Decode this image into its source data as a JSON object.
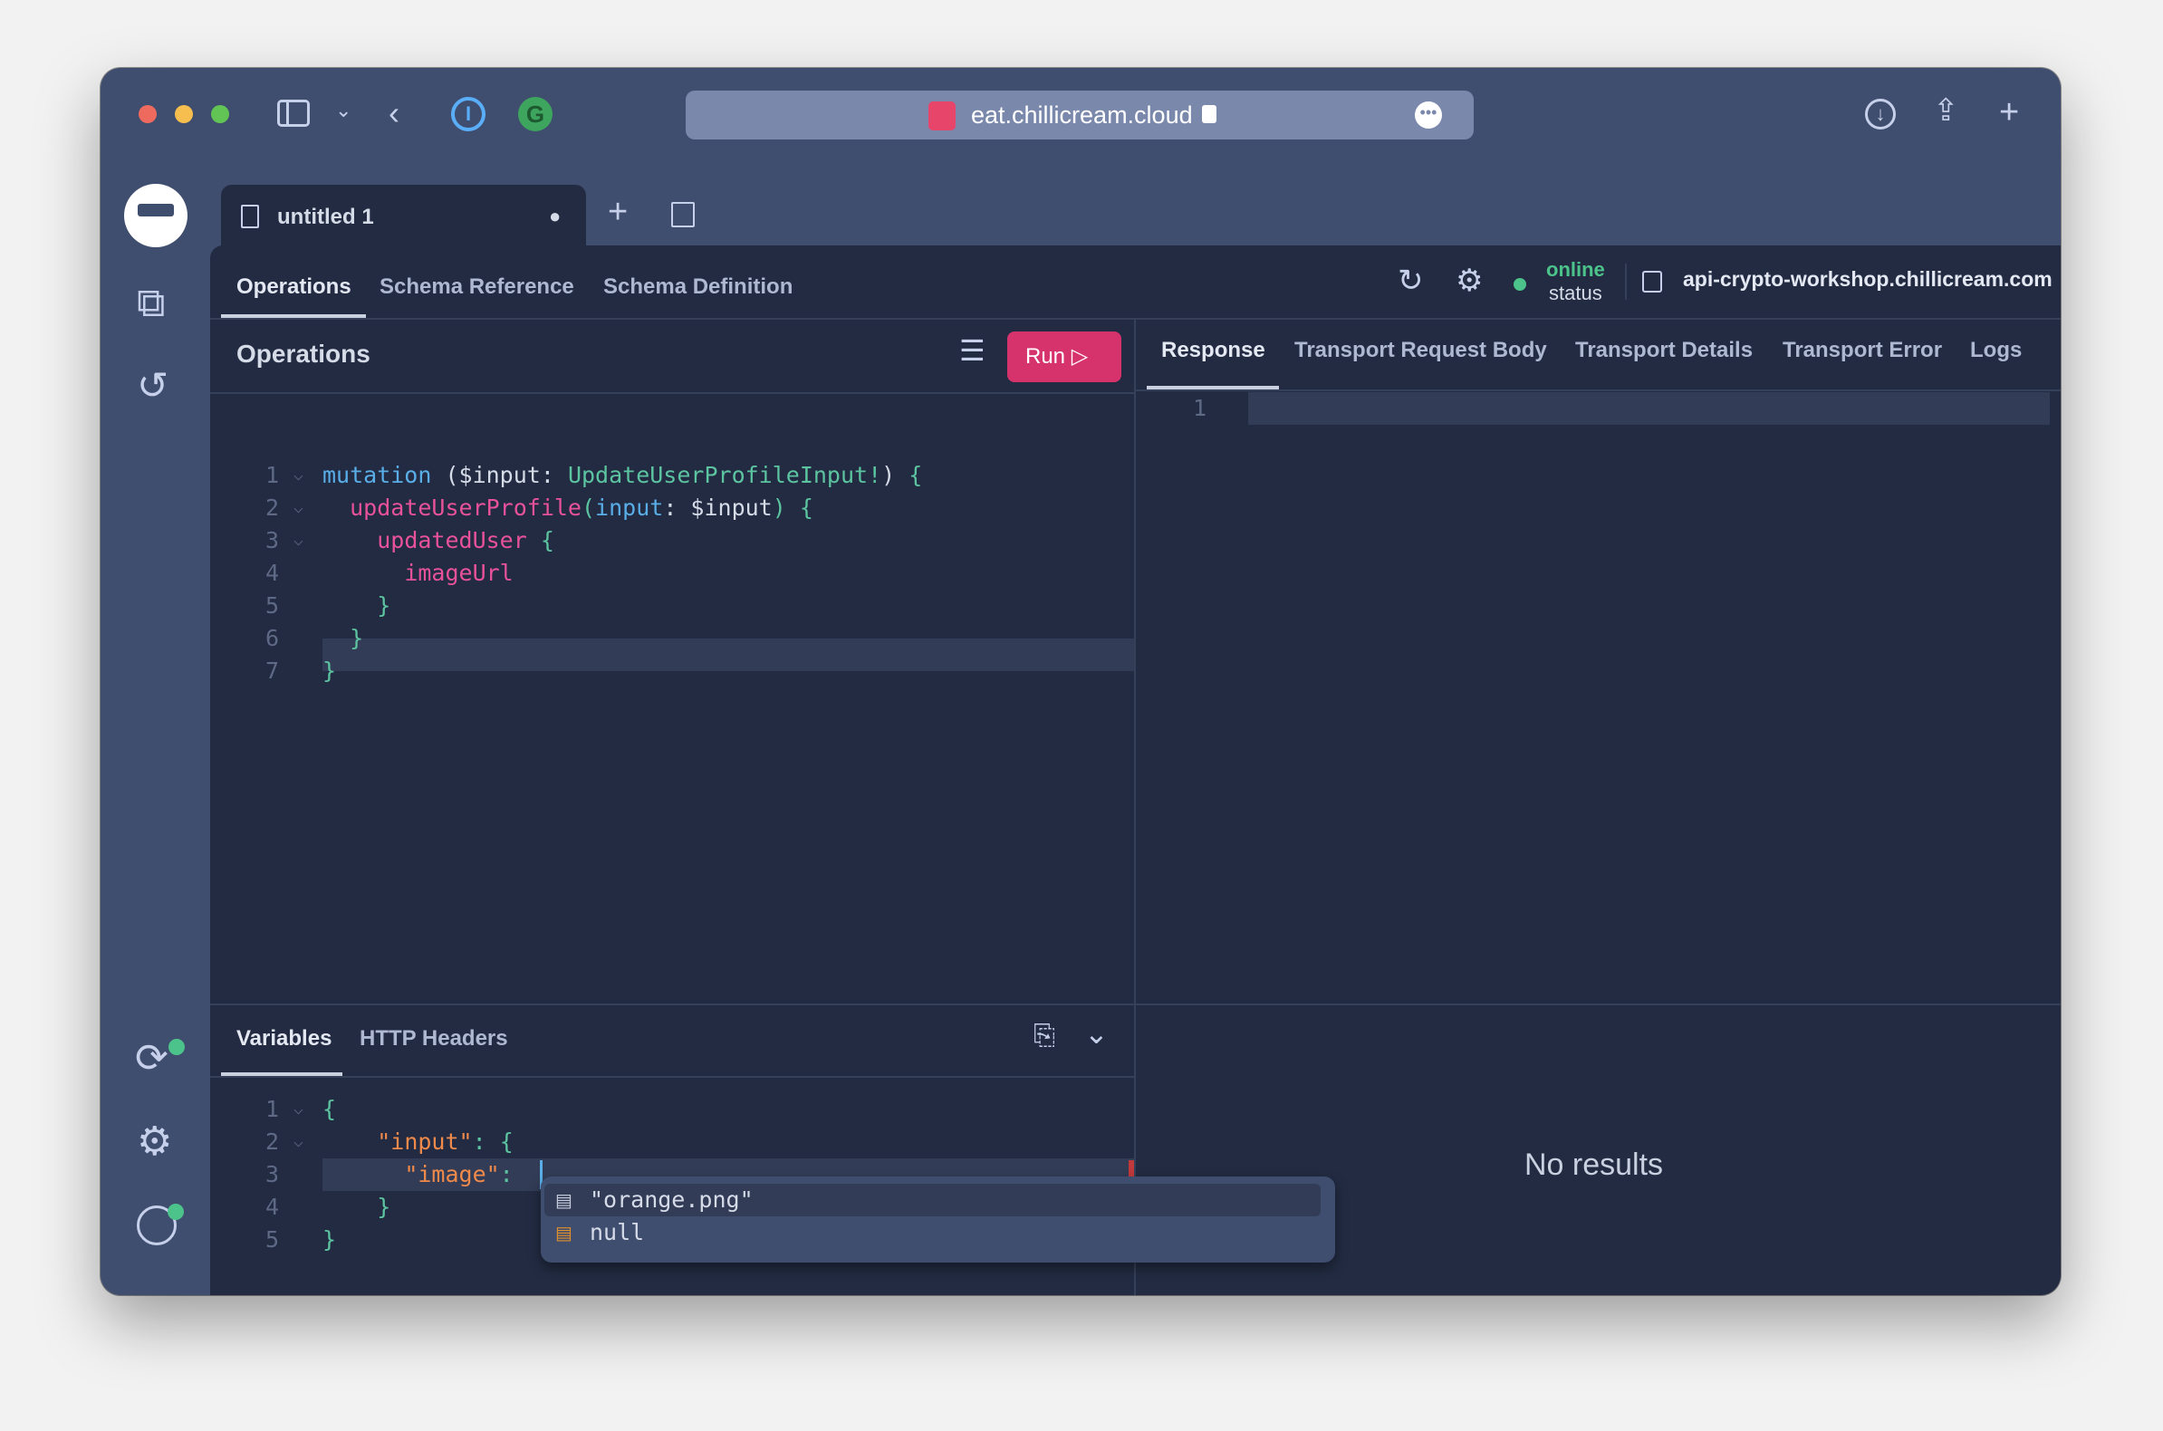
{
  "browser": {
    "url": "eat.chillicream.cloud",
    "icons": [
      "sidebar-icon",
      "chevron-down-icon",
      "back-icon",
      "1password-icon",
      "grammarly-icon",
      "lock-icon",
      "more-icon",
      "download-icon",
      "share-icon",
      "new-tab-icon"
    ]
  },
  "document_tab": {
    "title": "untitled 1",
    "unsaved_indicator": "●"
  },
  "top_tabs": [
    {
      "label": "Operations",
      "active": true
    },
    {
      "label": "Schema Reference"
    },
    {
      "label": "Schema Definition"
    }
  ],
  "connection": {
    "status": "online",
    "status_label": "status",
    "endpoint": "api-crypto-workshop.chillicream.com",
    "status_color": "#4cc38a"
  },
  "operations": {
    "title": "Operations",
    "run_label": "Run",
    "run_color": "#d6336c",
    "lines": [
      [
        [
          "kw",
          "mutation"
        ],
        [
          "pl",
          " ("
        ],
        [
          "pl",
          "$input"
        ],
        [
          "pl",
          ": "
        ],
        [
          "ty",
          "UpdateUserProfileInput!"
        ],
        [
          "pl",
          ") "
        ],
        [
          "br",
          "{"
        ]
      ],
      [
        [
          "pl",
          "  "
        ],
        [
          "fd",
          "updateUserProfile"
        ],
        [
          "br",
          "("
        ],
        [
          "kw",
          "input"
        ],
        [
          "pl",
          ": $input"
        ],
        [
          "br",
          ")"
        ],
        [
          "pl",
          " "
        ],
        [
          "br",
          "{"
        ]
      ],
      [
        [
          "pl",
          "    "
        ],
        [
          "fd",
          "updatedUser"
        ],
        [
          "pl",
          " "
        ],
        [
          "br",
          "{"
        ]
      ],
      [
        [
          "pl",
          "      "
        ],
        [
          "fd",
          "imageUrl"
        ]
      ],
      [
        [
          "pl",
          "    "
        ],
        [
          "br",
          "}"
        ]
      ],
      [
        [
          "pl",
          "  "
        ],
        [
          "br",
          "}"
        ]
      ],
      [
        [
          "br",
          "}"
        ]
      ]
    ]
  },
  "variables": {
    "tabs": [
      {
        "label": "Variables",
        "active": true
      },
      {
        "label": "HTTP Headers"
      }
    ],
    "lines": [
      [
        [
          "br",
          "{"
        ]
      ],
      [
        [
          "pl",
          "    "
        ],
        [
          "str",
          "\"input\""
        ],
        [
          "br",
          ": "
        ],
        [
          "br",
          "{"
        ]
      ],
      [
        [
          "pl",
          "      "
        ],
        [
          "str",
          "\"image\""
        ],
        [
          "br",
          ": "
        ]
      ],
      [
        [
          "pl",
          "    "
        ],
        [
          "br",
          "}"
        ]
      ],
      [
        [
          "br",
          "}"
        ]
      ]
    ]
  },
  "autocomplete": [
    "\"orange.png\"",
    "null"
  ],
  "response": {
    "tabs": [
      {
        "label": "Response",
        "active": true
      },
      {
        "label": "Transport Request Body"
      },
      {
        "label": "Transport Details"
      },
      {
        "label": "Transport Error"
      },
      {
        "label": "Logs"
      }
    ],
    "line": "1",
    "empty_text": "No results"
  }
}
